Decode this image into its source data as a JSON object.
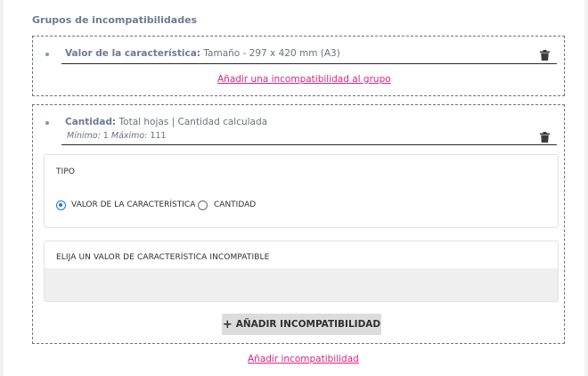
{
  "section_title": "Grupos de incompatibilidades",
  "group1": {
    "item_label": "Valor de la característica:",
    "item_value": "Tamaño - 297 x 420 mm (A3)",
    "add_link": "Añadir una incompatibilidad al grupo"
  },
  "group2": {
    "item_label": "Cantidad:",
    "item_value": "Total hojas | Cantidad calculada",
    "min_label": "Mínimo:",
    "min_value": "1",
    "max_label": "Máximo:",
    "max_value": "111",
    "tipo_label": "TIPO",
    "radio_options": [
      "VALOR DE LA CARACTERÍSTICA",
      "CANTIDAD"
    ],
    "selected_option": "VALOR DE LA CARACTERÍSTICA",
    "select_label": "ELIJA UN VALOR DE CARACTERÍSTICA INCOMPATIBLE",
    "add_button": "AÑADIR INCOMPATIBILIDAD"
  },
  "footer_link": "Añadir incompatibilidad",
  "colors": {
    "link": "#e0217a",
    "radio_selected": "#1a73e8",
    "title": "#6d7a94"
  },
  "icons": [
    "trash-icon",
    "plus-icon",
    "bullet-icon"
  ]
}
